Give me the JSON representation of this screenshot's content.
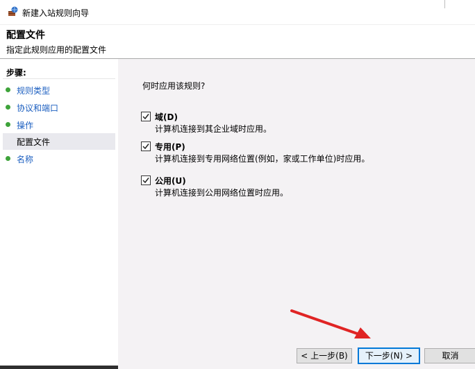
{
  "window": {
    "title": "新建入站规则向导",
    "app_icon": "firewall-wizard-icon"
  },
  "header": {
    "title": "配置文件",
    "subtitle": "指定此规则应用的配置文件"
  },
  "steps": {
    "label": "步骤:",
    "items": [
      {
        "label": "规则类型",
        "current": false
      },
      {
        "label": "协议和端口",
        "current": false
      },
      {
        "label": "操作",
        "current": false
      },
      {
        "label": "配置文件",
        "current": true
      },
      {
        "label": "名称",
        "current": false
      }
    ]
  },
  "main": {
    "question": "何时应用该规则?",
    "options": [
      {
        "name": "域(D)",
        "desc": "计算机连接到其企业域时应用。",
        "checked": true
      },
      {
        "name": "专用(P)",
        "desc": "计算机连接到专用网络位置(例如，家或工作单位)时应用。",
        "checked": true
      },
      {
        "name": "公用(U)",
        "desc": "计算机连接到公用网络位置时应用。",
        "checked": true
      }
    ]
  },
  "buttons": {
    "back": "< 上一步(B)",
    "next": "下一步(N) >",
    "cancel": "取消"
  },
  "colors": {
    "accent": "#0078d7",
    "step_link": "#1c5fc0",
    "step_dot": "#3ea33a",
    "annotation_arrow": "#e02424"
  }
}
